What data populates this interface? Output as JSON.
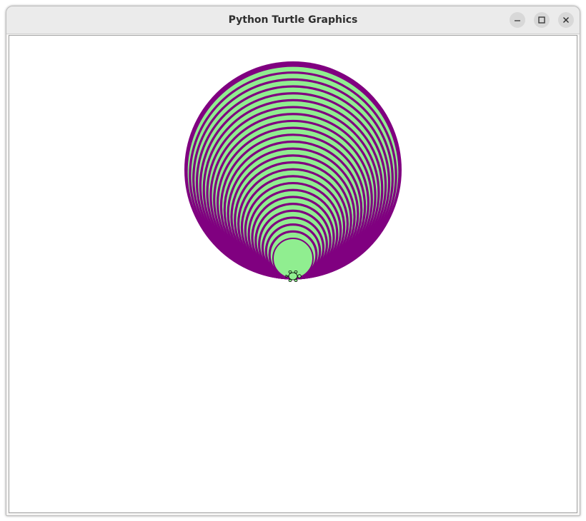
{
  "window": {
    "title": "Python Turtle Graphics",
    "controls": {
      "minimize": "minimize",
      "maximize": "maximize",
      "close": "close"
    }
  },
  "canvas": {
    "drawing": "concentric-circles-drawing",
    "colors": {
      "stroke": "#800080",
      "fill": "#90ee90",
      "outer_fill": "#800080"
    },
    "turtle": {
      "icon": "turtle-icon",
      "fill": "#90ee90"
    }
  }
}
